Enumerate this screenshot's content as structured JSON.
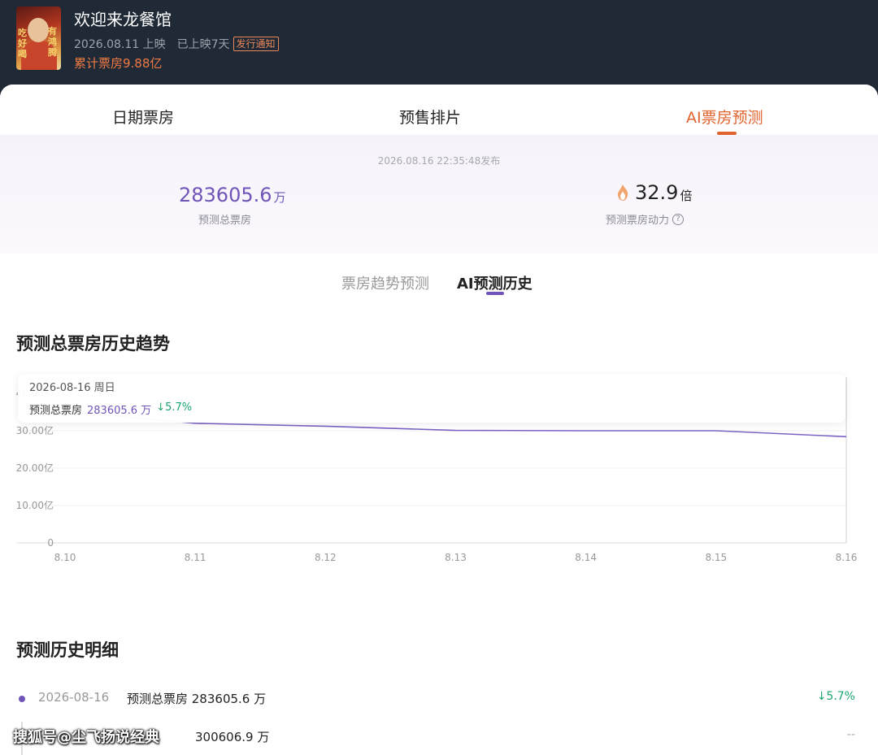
{
  "movie": {
    "title": "欢迎来龙餐馆",
    "release": "2026.08.11 上映",
    "days": "已上映7天",
    "notice": "发行通知",
    "cumulative": "累计票房9.88亿",
    "poster_text_left": "吃好喝",
    "poster_text_right": "有鸿腾"
  },
  "tabs": [
    {
      "label": "日期票房",
      "active": false
    },
    {
      "label": "预售排片",
      "active": false
    },
    {
      "label": "AI票房预测",
      "active": true
    }
  ],
  "summary": {
    "publish_time": "2026.08.16 22:35:48发布",
    "total_value": "283605.6",
    "total_unit": "万",
    "total_label": "预测总票房",
    "power_value": "32.9",
    "power_unit": "倍",
    "power_label": "预测票房动力",
    "help_icon": "question-circle-icon"
  },
  "subtabs": [
    {
      "label": "票房趋势预测",
      "active": false
    },
    {
      "label": "AI预测历史",
      "active": true
    }
  ],
  "sections": {
    "trend_title": "预测总票房历史趋势",
    "detail_title": "预测历史明细"
  },
  "tooltip": {
    "date": "2026-08-16 周日",
    "label": "预测总票房",
    "value": "283605.6 万",
    "change": "↓5.7%"
  },
  "chart_data": {
    "type": "line",
    "x": [
      "8.10",
      "8.11",
      "8.12",
      "8.13",
      "8.14",
      "8.15",
      "8.16"
    ],
    "series": [
      {
        "values": [
          35.2,
          32.0,
          31.2,
          30.1,
          30.0,
          30.0,
          28.4
        ],
        "color": "#7b63c4"
      }
    ],
    "yticks": [
      "0",
      "10.00亿",
      "20.00亿",
      "30.00亿",
      "40.00亿"
    ],
    "ylim": [
      0,
      40
    ],
    "grid": true,
    "highlight_index": 6
  },
  "history": [
    {
      "date": "2026-08-16",
      "text": "预测总票房 283605.6 万",
      "change": "↓5.7%"
    },
    {
      "date": "",
      "text": "300606.9 万",
      "change": "--"
    }
  ],
  "watermark": "搜狐号@尘飞扬说经典"
}
